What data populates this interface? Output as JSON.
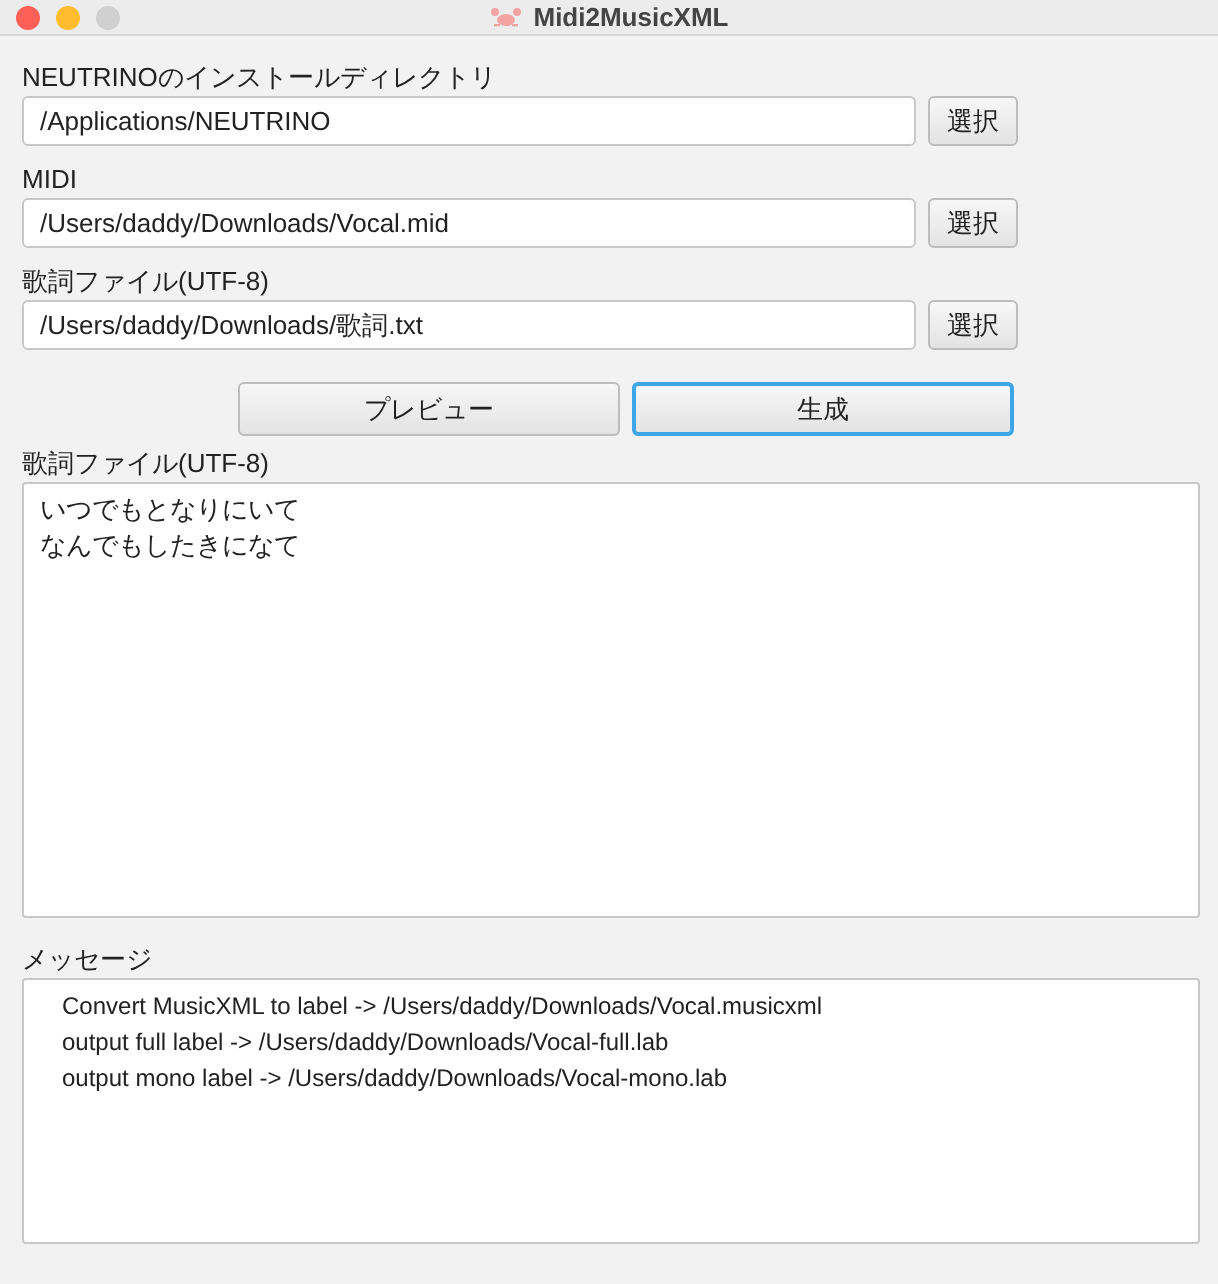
{
  "window": {
    "title": "Midi2MusicXML"
  },
  "fields": [
    {
      "label": "NEUTRINOのインストールディレクトリ",
      "value": "/Applications/NEUTRINO",
      "button": "選択"
    },
    {
      "label": "MIDI",
      "value": "/Users/daddy/Downloads/Vocal.mid",
      "button": "選択"
    },
    {
      "label": "歌詞ファイル(UTF-8)",
      "value": "/Users/daddy/Downloads/歌詞.txt",
      "button": "選択"
    }
  ],
  "actions": [
    {
      "label": "プレビュー",
      "focused": false
    },
    {
      "label": "生成",
      "focused": true
    }
  ],
  "lyrics": {
    "label": "歌詞ファイル(UTF-8)",
    "lines": [
      "いつでもとなりにいて",
      "なんでもしたきになて"
    ]
  },
  "messages": {
    "label": "メッセージ",
    "lines": [
      "Convert MusicXML to label -> /Users/daddy/Downloads/Vocal.musicxml",
      "output full label -> /Users/daddy/Downloads/Vocal-full.lab",
      "output mono label -> /Users/daddy/Downloads/Vocal-mono.lab"
    ]
  }
}
